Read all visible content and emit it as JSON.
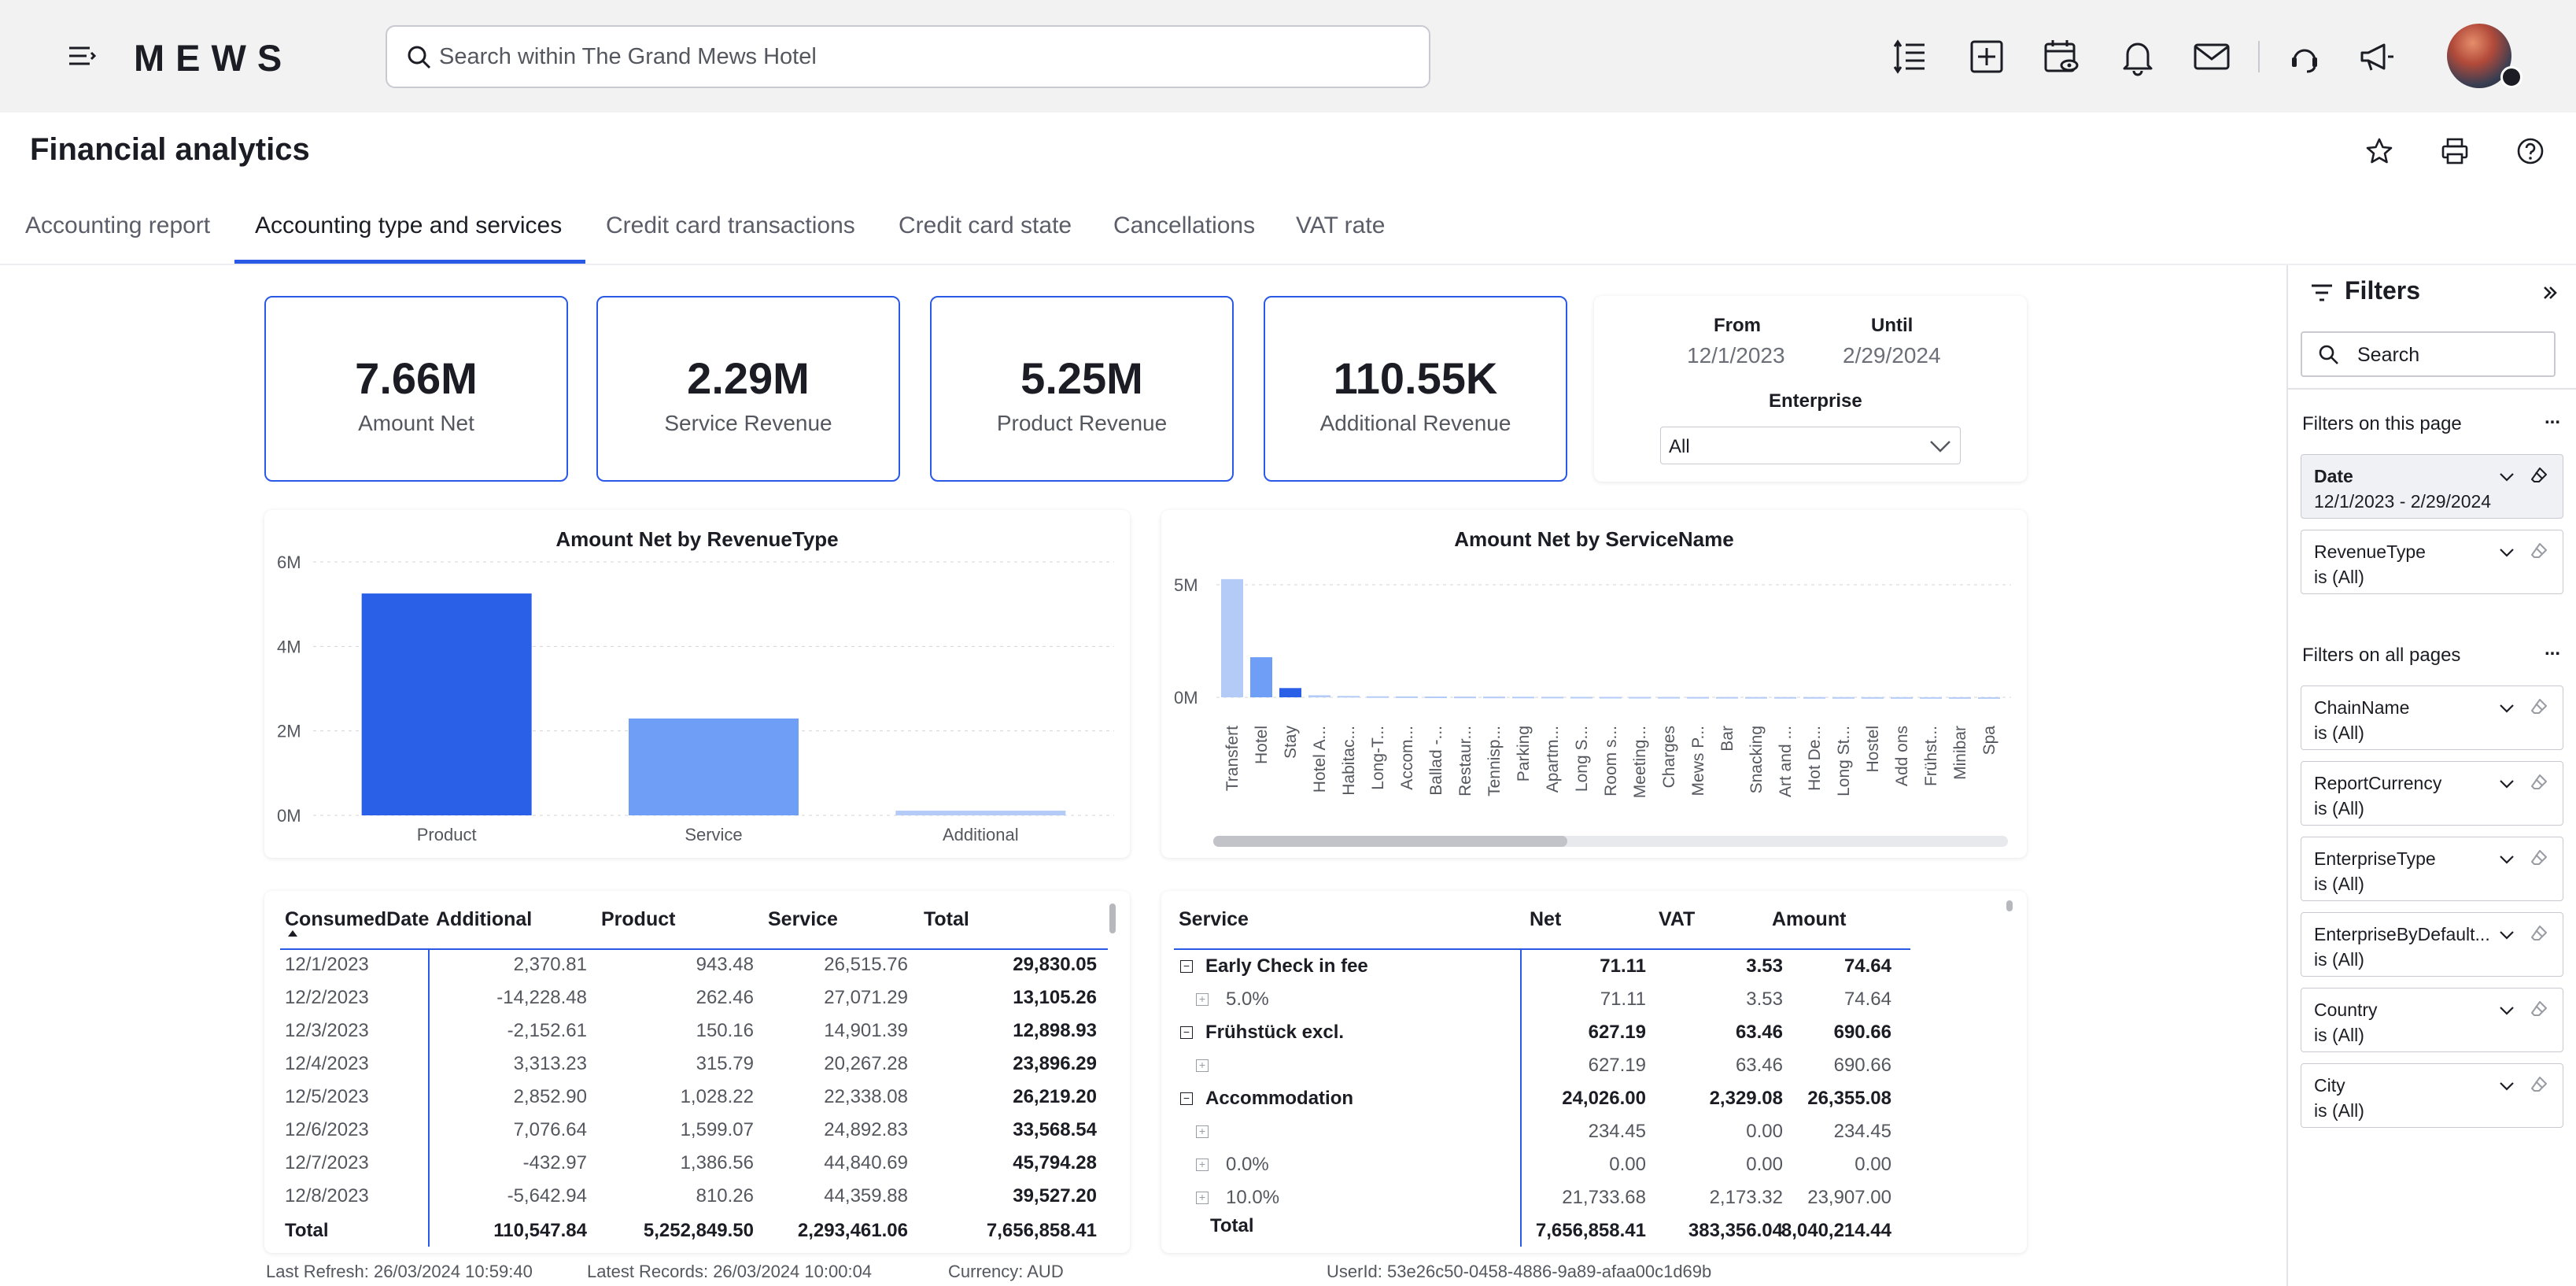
{
  "topbar": {
    "logo": "MEWS",
    "search_placeholder": "Search within The Grand Mews Hotel"
  },
  "page": {
    "title": "Financial analytics",
    "tabs": [
      {
        "label": "Accounting report",
        "active": false
      },
      {
        "label": "Accounting type and services",
        "active": true
      },
      {
        "label": "Credit card transactions",
        "active": false
      },
      {
        "label": "Credit card state",
        "active": false
      },
      {
        "label": "Cancellations",
        "active": false
      },
      {
        "label": "VAT rate",
        "active": false
      }
    ]
  },
  "kpis": [
    {
      "value": "7.66M",
      "label": "Amount Net"
    },
    {
      "value": "2.29M",
      "label": "Service Revenue"
    },
    {
      "value": "5.25M",
      "label": "Product Revenue"
    },
    {
      "value": "110.55K",
      "label": "Additional Revenue"
    }
  ],
  "date_filter": {
    "from_label": "From",
    "from_value": "12/1/2023",
    "until_label": "Until",
    "until_value": "2/29/2024",
    "enterprise_label": "Enterprise",
    "enterprise_value": "All"
  },
  "chart_data": [
    {
      "type": "bar",
      "title": "Amount Net by RevenueType",
      "categories": [
        "Product",
        "Service",
        "Additional"
      ],
      "values": [
        5252849.5,
        2293461.06,
        110547.84
      ],
      "yticks": [
        "0M",
        "2M",
        "4M",
        "6M"
      ],
      "ylim": [
        0,
        6000000
      ],
      "colors": [
        "#2a5fe8",
        "#6e9ef5",
        "#b4cbf7"
      ],
      "grid": true
    },
    {
      "type": "bar",
      "title": "Amount Net by ServiceName",
      "categories": [
        "Transfert",
        "Hotel",
        "Stay",
        "Hotel A...",
        "Habitac...",
        "Long-T...",
        "Accom...",
        "Ballad -...",
        "Restaur...",
        "Tennisp...",
        "Parking",
        "Apartm...",
        "Long S...",
        "Room s...",
        "Meeting...",
        "Charges",
        "Mews P...",
        "Bar",
        "Snacking",
        "Art and ...",
        "Hot De...",
        "Long St...",
        "Hostel",
        "Add ons",
        "Frühst...",
        "Minibar",
        "Spa"
      ],
      "values": [
        5250000,
        1780000,
        410000,
        90000,
        60000,
        45000,
        40000,
        35000,
        30000,
        28000,
        25000,
        22000,
        20000,
        18000,
        16000,
        15000,
        14000,
        13000,
        12000,
        11000,
        10000,
        9000,
        8000,
        7000,
        6000,
        5000,
        4000
      ],
      "yticks": [
        "0M",
        "5M"
      ],
      "ylim": [
        0,
        5000000
      ],
      "colors": {
        "first": "#b4cbf7",
        "second": "#6e9ef5",
        "third": "#2a5fe8",
        "rest": "#b4cbf7"
      },
      "grid": true
    }
  ],
  "table_dates": {
    "headers": [
      "ConsumedDate",
      "Additional",
      "Product",
      "Service",
      "Total"
    ],
    "rows": [
      [
        "12/1/2023",
        "2,370.81",
        "943.48",
        "26,515.76",
        "29,830.05"
      ],
      [
        "12/2/2023",
        "-14,228.48",
        "262.46",
        "27,071.29",
        "13,105.26"
      ],
      [
        "12/3/2023",
        "-2,152.61",
        "150.16",
        "14,901.39",
        "12,898.93"
      ],
      [
        "12/4/2023",
        "3,313.23",
        "315.79",
        "20,267.28",
        "23,896.29"
      ],
      [
        "12/5/2023",
        "2,852.90",
        "1,028.22",
        "22,338.08",
        "26,219.20"
      ],
      [
        "12/6/2023",
        "7,076.64",
        "1,599.07",
        "24,892.83",
        "33,568.54"
      ],
      [
        "12/7/2023",
        "-432.97",
        "1,386.56",
        "44,840.69",
        "45,794.28"
      ],
      [
        "12/8/2023",
        "-5,642.94",
        "810.26",
        "44,359.88",
        "39,527.20"
      ]
    ],
    "total": [
      "Total",
      "110,547.84",
      "5,252,849.50",
      "2,293,461.06",
      "7,656,858.41"
    ]
  },
  "table_services": {
    "headers": [
      "Service",
      "Net",
      "VAT",
      "Amount"
    ],
    "rows": [
      {
        "label": "Early Check in fee",
        "level": 0,
        "net": "71.11",
        "vat": "3.53",
        "amount": "74.64"
      },
      {
        "label": "5.0%",
        "level": 1,
        "net": "71.11",
        "vat": "3.53",
        "amount": "74.64"
      },
      {
        "label": "Frühstück excl.",
        "level": 0,
        "net": "627.19",
        "vat": "63.46",
        "amount": "690.66"
      },
      {
        "label": "",
        "level": 1,
        "net": "627.19",
        "vat": "63.46",
        "amount": "690.66"
      },
      {
        "label": "Accommodation",
        "level": 0,
        "net": "24,026.00",
        "vat": "2,329.08",
        "amount": "26,355.08"
      },
      {
        "label": "",
        "level": 1,
        "net": "234.45",
        "vat": "0.00",
        "amount": "234.45"
      },
      {
        "label": "0.0%",
        "level": 1,
        "net": "0.00",
        "vat": "0.00",
        "amount": "0.00"
      },
      {
        "label": "10.0%",
        "level": 1,
        "net": "21,733.68",
        "vat": "2,173.32",
        "amount": "23,907.00"
      }
    ],
    "total": {
      "label": "Total",
      "net": "7,656,858.41",
      "vat": "383,356.04",
      "amount": "8,040,214.44"
    }
  },
  "footer": {
    "last_refresh": "Last Refresh: 26/03/2024 10:59:40",
    "latest_records": "Latest Records: 26/03/2024 10:00:04",
    "currency": "Currency: AUD",
    "user_id": "UserId: 53e26c50-0458-4886-9a89-afaa00c1d69b"
  },
  "filters": {
    "title": "Filters",
    "search_placeholder": "Search",
    "section_page": "Filters on this page",
    "section_all": "Filters on all pages",
    "page_filters": [
      {
        "name": "Date",
        "value": "12/1/2023 - 2/29/2024",
        "active": true
      },
      {
        "name": "RevenueType",
        "value": "is (All)",
        "active": false
      }
    ],
    "all_filters": [
      {
        "name": "ChainName",
        "value": "is (All)"
      },
      {
        "name": "ReportCurrency",
        "value": "is (All)"
      },
      {
        "name": "EnterpriseType",
        "value": "is (All)"
      },
      {
        "name": "EnterpriseByDefault...",
        "value": "is (All)"
      },
      {
        "name": "Country",
        "value": "is (All)"
      },
      {
        "name": "City",
        "value": "is (All)"
      }
    ],
    "more_label": "..."
  }
}
